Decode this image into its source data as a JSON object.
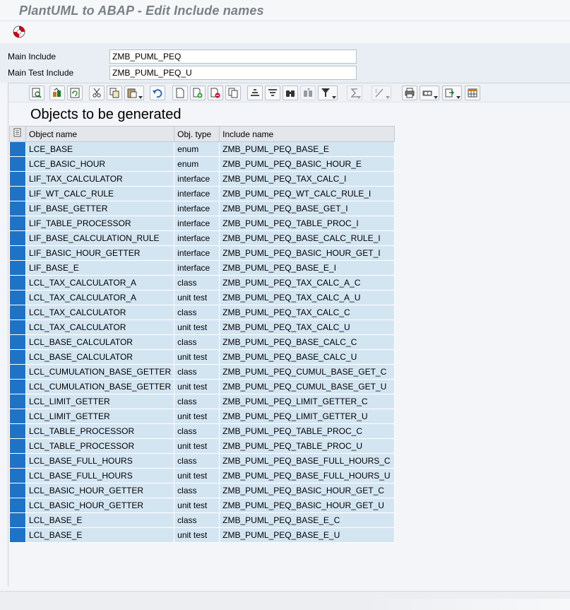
{
  "window": {
    "title": "PlantUML to ABAP - Edit Include names"
  },
  "appbar": {
    "exit_icon": "exit-lifebuoy-icon"
  },
  "fields": {
    "main_include": {
      "label": "Main Include",
      "value": "ZMB_PUML_PEQ"
    },
    "main_test_include": {
      "label": "Main Test Include",
      "value": "ZMB_PUML_PEQ_U"
    }
  },
  "toolbar": {
    "icons": [
      "details-icon",
      "check-entries-icon",
      "refresh-icon",
      "cut-icon",
      "copy-icon",
      "paste-icon",
      "undo-icon",
      "append-row-icon",
      "insert-row-icon",
      "delete-row-icon",
      "copy-row-icon",
      "sort-ascending-icon",
      "sort-descending-icon",
      "find-icon",
      "find-next-icon",
      "filter-icon",
      "total-icon",
      "subtotal-icon",
      "print-icon",
      "views-icon",
      "export-icon",
      "layout-icon"
    ]
  },
  "grid": {
    "title": "Objects to be generated",
    "columns": {
      "name": "Object name",
      "type": "Obj. type",
      "include": "Include name"
    },
    "rows": [
      {
        "name": "LCE_BASE",
        "type": "enum",
        "include": "ZMB_PUML_PEQ_BASE_E"
      },
      {
        "name": "LCE_BASIC_HOUR",
        "type": "enum",
        "include": "ZMB_PUML_PEQ_BASIC_HOUR_E"
      },
      {
        "name": "LIF_TAX_CALCULATOR",
        "type": "interface",
        "include": "ZMB_PUML_PEQ_TAX_CALC_I"
      },
      {
        "name": "LIF_WT_CALC_RULE",
        "type": "interface",
        "include": "ZMB_PUML_PEQ_WT_CALC_RULE_I"
      },
      {
        "name": "LIF_BASE_GETTER",
        "type": "interface",
        "include": "ZMB_PUML_PEQ_BASE_GET_I"
      },
      {
        "name": "LIF_TABLE_PROCESSOR",
        "type": "interface",
        "include": "ZMB_PUML_PEQ_TABLE_PROC_I"
      },
      {
        "name": "LIF_BASE_CALCULATION_RULE",
        "type": "interface",
        "include": "ZMB_PUML_PEQ_BASE_CALC_RULE_I"
      },
      {
        "name": "LIF_BASIC_HOUR_GETTER",
        "type": "interface",
        "include": "ZMB_PUML_PEQ_BASIC_HOUR_GET_I"
      },
      {
        "name": "LIF_BASE_E",
        "type": "interface",
        "include": "ZMB_PUML_PEQ_BASE_E_I"
      },
      {
        "name": "LCL_TAX_CALCULATOR_A",
        "type": "class",
        "include": "ZMB_PUML_PEQ_TAX_CALC_A_C"
      },
      {
        "name": "LCL_TAX_CALCULATOR_A",
        "type": "unit test",
        "include": "ZMB_PUML_PEQ_TAX_CALC_A_U"
      },
      {
        "name": "LCL_TAX_CALCULATOR",
        "type": "class",
        "include": "ZMB_PUML_PEQ_TAX_CALC_C"
      },
      {
        "name": "LCL_TAX_CALCULATOR",
        "type": "unit test",
        "include": "ZMB_PUML_PEQ_TAX_CALC_U"
      },
      {
        "name": "LCL_BASE_CALCULATOR",
        "type": "class",
        "include": "ZMB_PUML_PEQ_BASE_CALC_C"
      },
      {
        "name": "LCL_BASE_CALCULATOR",
        "type": "unit test",
        "include": "ZMB_PUML_PEQ_BASE_CALC_U"
      },
      {
        "name": "LCL_CUMULATION_BASE_GETTER",
        "type": "class",
        "include": "ZMB_PUML_PEQ_CUMUL_BASE_GET_C"
      },
      {
        "name": "LCL_CUMULATION_BASE_GETTER",
        "type": "unit test",
        "include": "ZMB_PUML_PEQ_CUMUL_BASE_GET_U"
      },
      {
        "name": "LCL_LIMIT_GETTER",
        "type": "class",
        "include": "ZMB_PUML_PEQ_LIMIT_GETTER_C"
      },
      {
        "name": "LCL_LIMIT_GETTER",
        "type": "unit test",
        "include": "ZMB_PUML_PEQ_LIMIT_GETTER_U"
      },
      {
        "name": "LCL_TABLE_PROCESSOR",
        "type": "class",
        "include": "ZMB_PUML_PEQ_TABLE_PROC_C"
      },
      {
        "name": "LCL_TABLE_PROCESSOR",
        "type": "unit test",
        "include": "ZMB_PUML_PEQ_TABLE_PROC_U"
      },
      {
        "name": "LCL_BASE_FULL_HOURS",
        "type": "class",
        "include": "ZMB_PUML_PEQ_BASE_FULL_HOURS_C"
      },
      {
        "name": "LCL_BASE_FULL_HOURS",
        "type": "unit test",
        "include": "ZMB_PUML_PEQ_BASE_FULL_HOURS_U"
      },
      {
        "name": "LCL_BASIC_HOUR_GETTER",
        "type": "class",
        "include": "ZMB_PUML_PEQ_BASIC_HOUR_GET_C"
      },
      {
        "name": "LCL_BASIC_HOUR_GETTER",
        "type": "unit test",
        "include": "ZMB_PUML_PEQ_BASIC_HOUR_GET_U"
      },
      {
        "name": "LCL_BASE_E",
        "type": "class",
        "include": "ZMB_PUML_PEQ_BASE_E_C"
      },
      {
        "name": "LCL_BASE_E",
        "type": "unit test",
        "include": "ZMB_PUML_PEQ_BASE_E_U"
      }
    ]
  },
  "colors": {
    "row_bg": "#d4e5f2",
    "row_marker": "#1f73c7",
    "header_bg": "#e3e6ea",
    "exit_icon": "#d0021b"
  }
}
